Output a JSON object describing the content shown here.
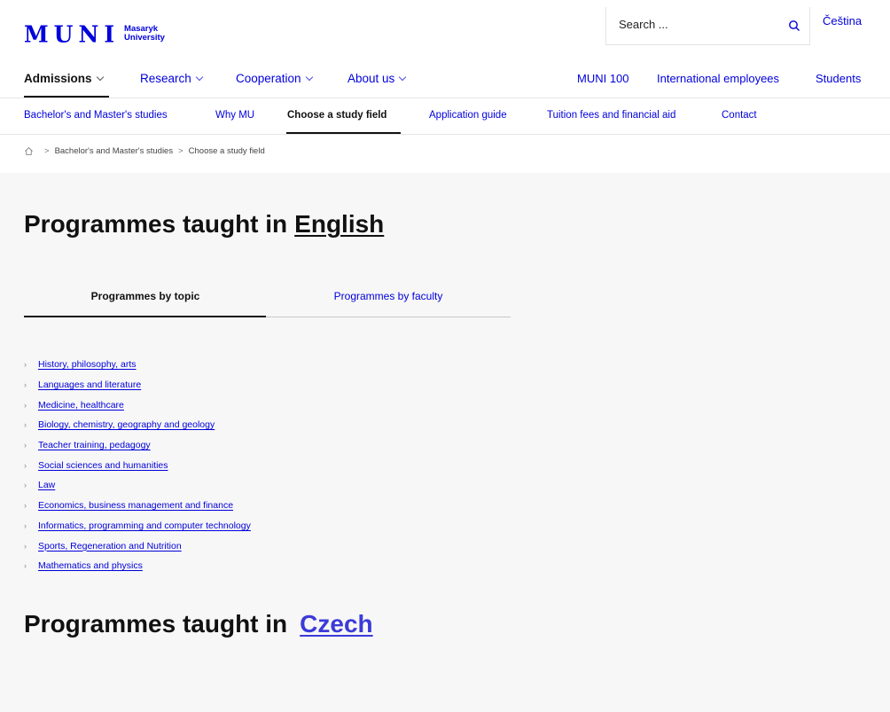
{
  "header": {
    "logo_mark": "MUNI",
    "logo_line1": "Masaryk",
    "logo_line2": "University",
    "search_placeholder": "Search ...",
    "language": "Čeština"
  },
  "main_nav": {
    "items": [
      {
        "label": "Admissions"
      },
      {
        "label": "Research"
      },
      {
        "label": "Cooperation"
      },
      {
        "label": "About us"
      }
    ],
    "right": [
      {
        "label": "MUNI 100"
      },
      {
        "label": "International employees"
      },
      {
        "label": "Students"
      }
    ]
  },
  "sub_nav": {
    "items": [
      {
        "label": "Bachelor's and Master's studies"
      },
      {
        "label": "Why MU"
      },
      {
        "label": "Choose a study field"
      },
      {
        "label": "Application guide"
      },
      {
        "label": "Tuition fees and financial aid"
      },
      {
        "label": "Contact"
      }
    ]
  },
  "breadcrumb": {
    "items": [
      "Bachelor's and Master's studies",
      "Choose a study field"
    ],
    "separator": ">"
  },
  "english": {
    "title_prefix": "Programmes taught in",
    "title_link": "English"
  },
  "tabs": [
    {
      "label": "Programmes by topic"
    },
    {
      "label": "Programmes by faculty"
    }
  ],
  "topics": [
    "History, philosophy, arts",
    "Languages and literature",
    "Medicine, healthcare",
    "Biology, chemistry, geography and geology",
    "Teacher training, pedagogy",
    "Social sciences and humanities",
    "Law",
    "Economics, business management and finance",
    "Informatics, programming and computer technology",
    "Sports, Regeneration and Nutrition",
    "Mathematics and physics"
  ],
  "czech": {
    "title_prefix": "Programmes taught in",
    "title_link": "Czech"
  },
  "colors": {
    "link": "#0000dc",
    "content_bg": "#f7f7f7",
    "czech_link": "#3b3bd8"
  }
}
